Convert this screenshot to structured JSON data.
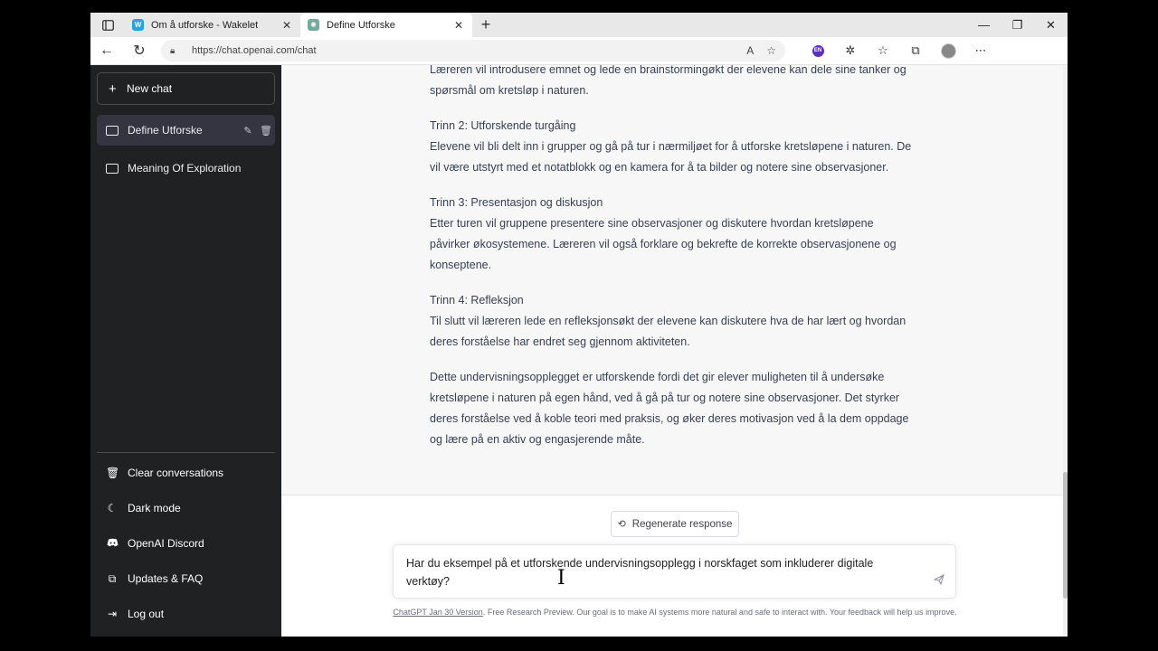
{
  "browser": {
    "tabs": [
      {
        "title": "Om å utforske - Wakelet",
        "favicon": "W",
        "active": false
      },
      {
        "title": "Define Utforske",
        "favicon": "gpt",
        "active": true
      }
    ],
    "url": "https://chat.openai.com/chat",
    "ext_badge": "EN"
  },
  "sidebar": {
    "new_chat": "New chat",
    "conversations": [
      {
        "label": "Define Utforske",
        "active": true
      },
      {
        "label": "Meaning Of Exploration",
        "active": false
      }
    ],
    "menu": [
      {
        "label": "Clear conversations",
        "icon": "trash-icon"
      },
      {
        "label": "Dark mode",
        "icon": "moon-icon"
      },
      {
        "label": "OpenAI Discord",
        "icon": "discord-icon"
      },
      {
        "label": "Updates & FAQ",
        "icon": "external-link-icon"
      },
      {
        "label": "Log out",
        "icon": "logout-icon"
      }
    ]
  },
  "response": {
    "p1": "Læreren vil introdusere emnet og lede en brainstormingøkt der elevene kan dele sine tanker og spørsmål om kretsløp i naturen.",
    "step2_title": "Trinn 2: Utforskende turgåing",
    "step2_text": "Elevene vil bli delt inn i grupper og gå på tur i nærmiljøet for å utforske kretsløpene i naturen. De vil være utstyrt med et notatblokk og en kamera for å ta bilder og notere sine observasjoner.",
    "step3_title": "Trinn 3: Presentasjon og diskusjon",
    "step3_text": "Etter turen vil gruppene presentere sine observasjoner og diskutere hvordan kretsløpene påvirker økosystemene. Læreren vil også forklare og bekrefte de korrekte observasjonene og konseptene.",
    "step4_title": "Trinn 4: Refleksjon",
    "step4_text": "Til slutt vil læreren lede en refleksjonsøkt der elevene kan diskutere hva de har lært og hvordan deres forståelse har endret seg gjennom aktiviteten.",
    "conclusion": "Dette undervisningsopplegget er utforskende fordi det gir elever muligheten til å undersøke kretsløpene i naturen på egen hånd, ved å gå på tur og notere sine observasjoner. Det styrker deres forståelse ved å koble teori med praksis, og øker deres motivasjon ved å la dem oppdage og lære på en aktiv og engasjerende måte."
  },
  "regenerate": "Regenerate response",
  "input": {
    "value": "Har du eksempel på et utforskende undervisningsopplegg i norskfaget som inkluderer digitale verktøy?"
  },
  "footer": {
    "link": "ChatGPT Jan 30 Version",
    "text": ". Free Research Preview. Our goal is to make AI systems more natural and safe to interact with. Your feedback will help us improve."
  }
}
